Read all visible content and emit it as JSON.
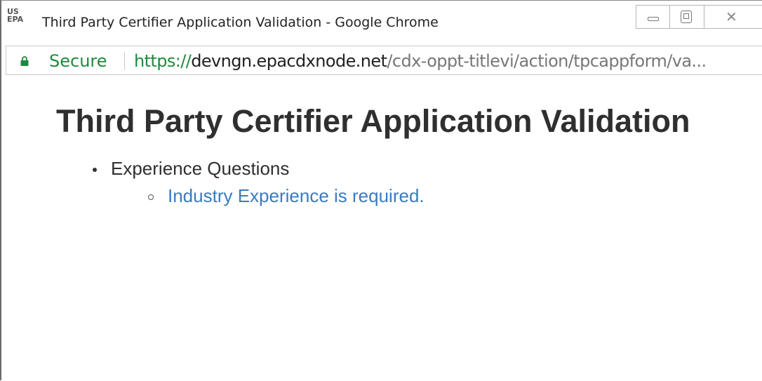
{
  "window": {
    "favicon_line1": "US",
    "favicon_line2": "EPA",
    "title": "Third Party Certifier Application Validation - Google Chrome"
  },
  "addressbar": {
    "secure_label": "Secure",
    "url_scheme": "https://",
    "url_host": "devngn.epacdxnode.net",
    "url_path": "/cdx-oppt-titlevi/action/tpcappform/va..."
  },
  "page": {
    "title": "Third Party Certifier Application Validation",
    "sections": [
      {
        "label": "Experience Questions",
        "errors": [
          "Industry Experience is required."
        ]
      }
    ]
  },
  "colors": {
    "secure_green": "#1e8a3d",
    "error_link_blue": "#3a7bbf",
    "heading_text": "#2f2f2f"
  }
}
